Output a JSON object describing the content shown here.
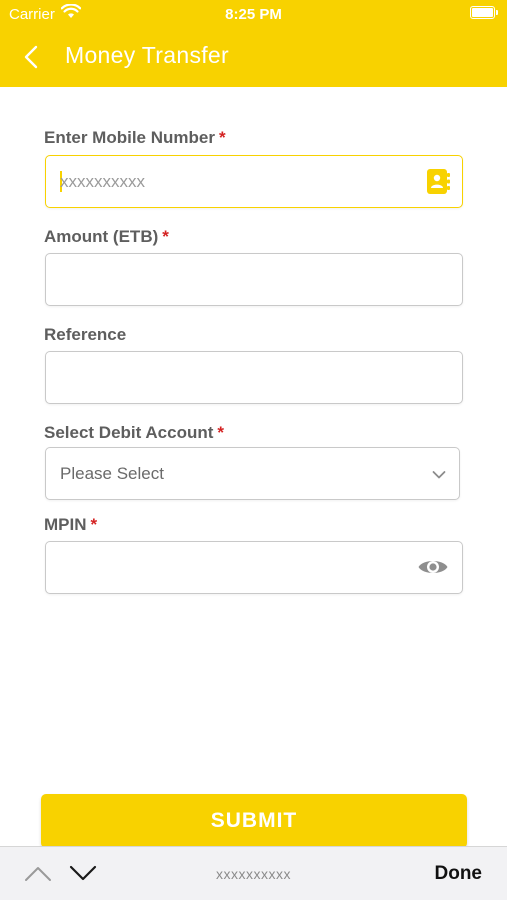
{
  "status_bar": {
    "carrier": "Carrier",
    "time": "8:25 PM"
  },
  "header": {
    "title": "Money Transfer"
  },
  "form": {
    "mobile": {
      "label": "Enter Mobile Number",
      "required_mark": "*",
      "placeholder": "xxxxxxxxxx"
    },
    "amount": {
      "label": "Amount (ETB)",
      "required_mark": "*",
      "value": ""
    },
    "reference": {
      "label": "Reference",
      "value": ""
    },
    "debit_account": {
      "label": "Select Debit Account",
      "required_mark": "*",
      "selected": "Please Select"
    },
    "mpin": {
      "label": "MPIN",
      "required_mark": "*",
      "value": ""
    }
  },
  "submit_label": "SUBMIT",
  "keyboard_toolbar": {
    "preview": "xxxxxxxxxx",
    "done_label": "Done"
  },
  "icons": {
    "back": "chevron-left-icon",
    "contact": "contact-book-icon",
    "dropdown": "chevron-down-icon",
    "mpin_visibility": "eye-icon",
    "toolbar_up": "chevron-up-icon",
    "toolbar_down": "chevron-down-icon"
  },
  "colors": {
    "brand_yellow": "#f8d200",
    "required_red": "#d42222"
  }
}
